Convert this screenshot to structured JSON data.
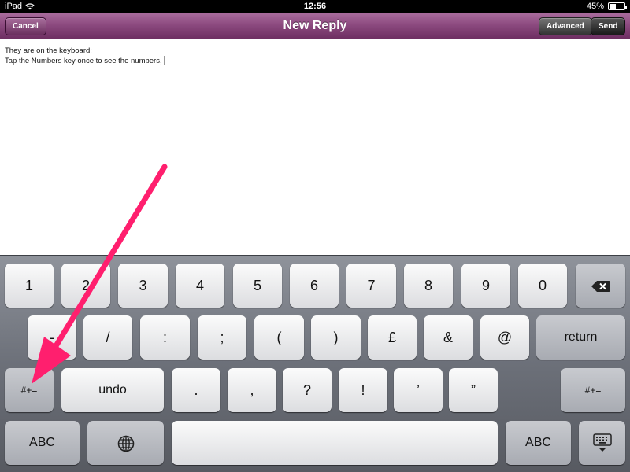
{
  "status_bar": {
    "device": "iPad",
    "time": "12:56",
    "battery_percent": "45%",
    "battery_level": 0.45
  },
  "navbar": {
    "title": "New Reply",
    "cancel_label": "Cancel",
    "advanced_label": "Advanced",
    "send_label": "Send"
  },
  "editor": {
    "line1": "They are on the keyboard:",
    "line2": "Tap the Numbers key once to see the numbers,"
  },
  "keyboard": {
    "row1": [
      "1",
      "2",
      "3",
      "4",
      "5",
      "6",
      "7",
      "8",
      "9",
      "0"
    ],
    "row2": [
      "-",
      "/",
      ":",
      ";",
      "(",
      ")",
      "£",
      "&",
      "@"
    ],
    "return_label": "return",
    "shift_symbols_label": "#+=",
    "undo_label": "undo",
    "row3": [
      ".",
      ",",
      "?",
      "!",
      "’",
      "”"
    ],
    "abc_label": "ABC"
  },
  "colors": {
    "annotation_arrow": "#ff1f6e",
    "navbar": "#8c4a7f"
  },
  "icons": {
    "backspace": "backspace-icon",
    "globe": "globe-icon",
    "dismiss": "keyboard-dismiss-icon",
    "wifi": "wifi-icon",
    "battery": "battery-icon"
  }
}
